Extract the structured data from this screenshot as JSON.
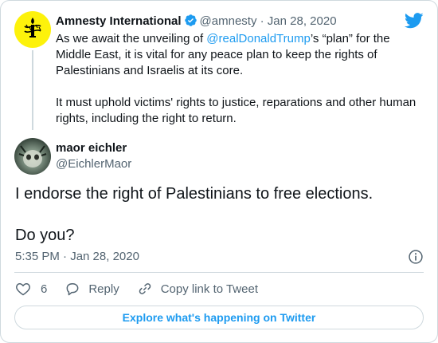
{
  "parent_tweet": {
    "author_name": "Amnesty International",
    "handle": "@amnesty",
    "separator": "·",
    "date": "Jan 28, 2020",
    "text_before_mention": "As we await the unveiling of ",
    "mention": "@realDonaldTrump",
    "text_after_mention": "’s “plan” for the Middle East, it is vital for any peace plan to keep the rights of Palestinians and Israelis at its core.",
    "paragraph_2": "It must uphold victims' rights to justice, reparations and other human rights, including the right to return."
  },
  "main_tweet": {
    "author_name": "maor eichler",
    "handle": "@EichlerMaor",
    "paragraph_1": "I endorse the right of Palestinians to free elections.",
    "paragraph_2": "Do you?",
    "timestamp": "5:35 PM · Jan 28, 2020"
  },
  "actions": {
    "like_count": "6",
    "reply_label": "Reply",
    "copy_link_label": "Copy link to Tweet"
  },
  "explore_button_label": "Explore what's happening on Twitter",
  "colors": {
    "accent": "#1d9bf0",
    "text": "#0f1419",
    "muted": "#536471",
    "border": "#cfd9de",
    "amnesty_yellow": "#fdf20b"
  },
  "icons": {
    "parent_avatar": "amnesty-candle-logo",
    "verified": "verified-badge-icon",
    "brand": "twitter-bird-icon",
    "info": "info-icon",
    "like": "heart-icon",
    "reply": "reply-bubble-icon",
    "copy_link": "link-icon"
  }
}
